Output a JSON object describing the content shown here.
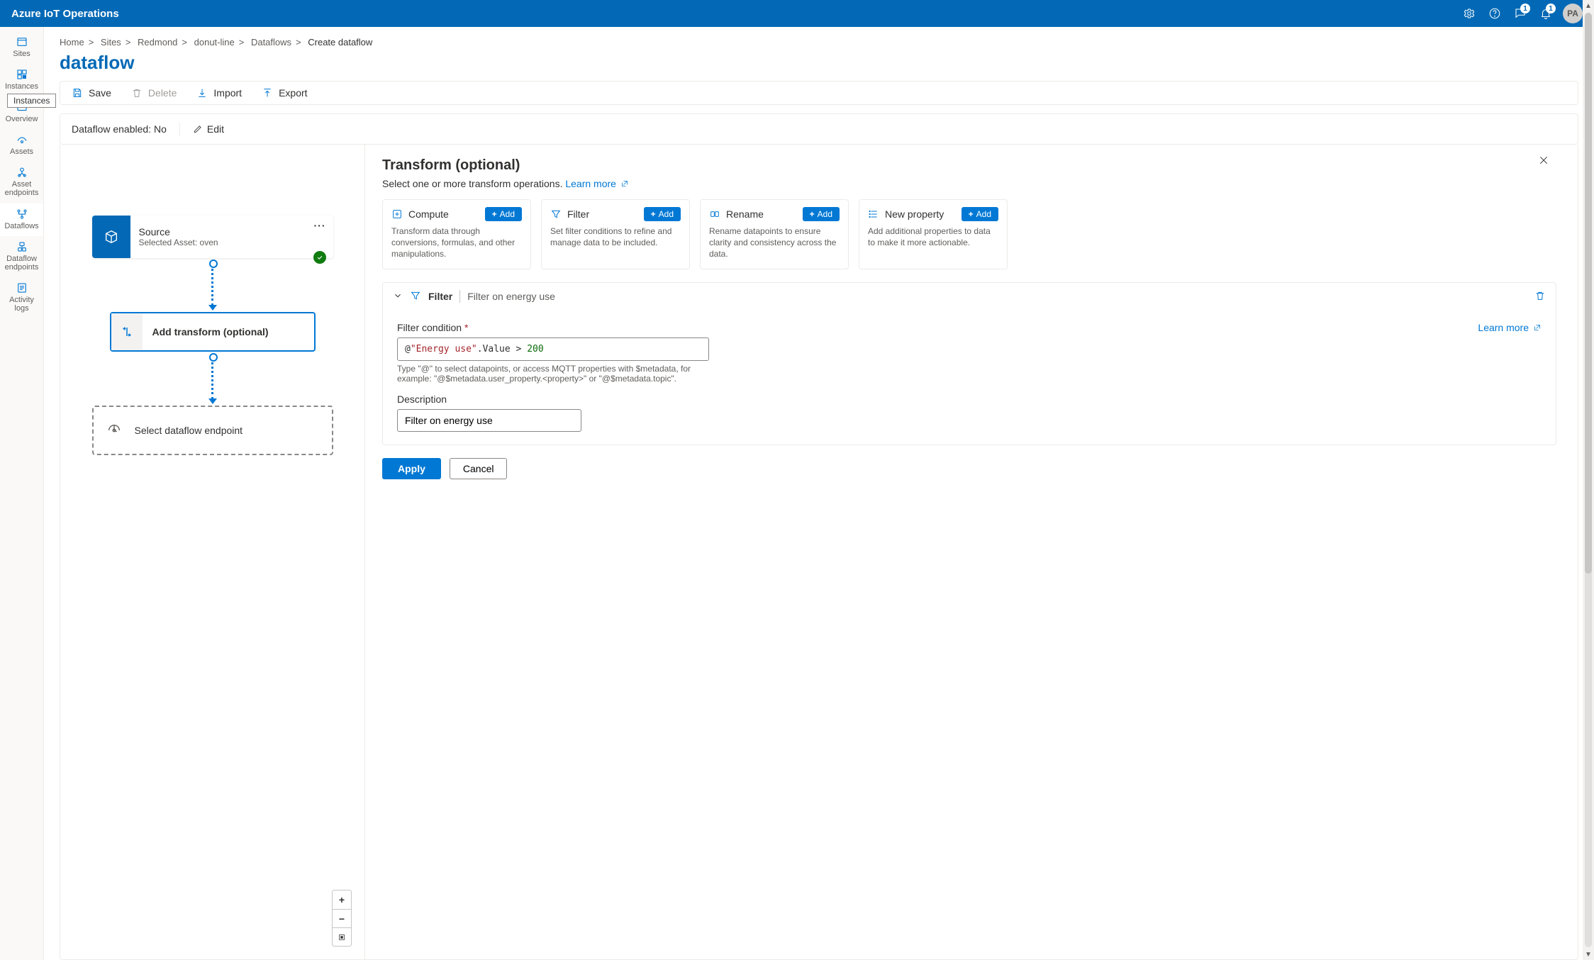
{
  "header": {
    "brand": "Azure IoT Operations",
    "badge1": "1",
    "badge2": "1",
    "avatar": "PA"
  },
  "rail": {
    "tooltip": "Instances",
    "items": [
      {
        "label": "Sites"
      },
      {
        "label": "Instances"
      },
      {
        "label": "Overview"
      },
      {
        "label": "Assets"
      },
      {
        "label": "Asset\nendpoints"
      },
      {
        "label": "Dataflows"
      },
      {
        "label": "Dataflow\nendpoints"
      },
      {
        "label": "Activity\nlogs"
      }
    ]
  },
  "breadcrumbs": {
    "items": [
      "Home",
      "Sites",
      "Redmond",
      "donut-line",
      "Dataflows",
      "Create dataflow"
    ]
  },
  "page": {
    "title": "dataflow"
  },
  "toolbar": {
    "save": "Save",
    "delete": "Delete",
    "import": "Import",
    "export": "Export"
  },
  "enabled": {
    "text": "Dataflow enabled: No",
    "edit": "Edit"
  },
  "canvas": {
    "source_title": "Source",
    "source_sub": "Selected Asset: oven",
    "transform_label": "Add transform (optional)",
    "endpoint_label": "Select dataflow endpoint"
  },
  "panel": {
    "title": "Transform (optional)",
    "subtitle": "Select one or more transform operations. ",
    "learn_more": "Learn more",
    "tiles": [
      {
        "name": "Compute",
        "desc": "Transform data through conversions, formulas, and other manipulations.",
        "btn": "Add"
      },
      {
        "name": "Filter",
        "desc": "Set filter conditions to refine and manage data to be included.",
        "btn": "Add"
      },
      {
        "name": "Rename",
        "desc": "Rename datapoints to ensure clarity and consistency across the data.",
        "btn": "Add"
      },
      {
        "name": "New property",
        "desc": "Add additional properties to data to make it more actionable.",
        "btn": "Add"
      }
    ],
    "filter_block": {
      "label": "Filter",
      "summary": "Filter on energy use",
      "condition_label": "Filter condition",
      "learn": "Learn more",
      "condition_value_parts": {
        "at": "@",
        "str": "\"Energy use\"",
        "prop": ".Value",
        "op": " > ",
        "num": "200"
      },
      "hint": "Type \"@\" to select datapoints, or access MQTT properties with $metadata, for example: \"@$metadata.user_property.<property>\" or \"@$metadata.topic\".",
      "desc_label": "Description",
      "desc_value": "Filter on energy use"
    },
    "actions": {
      "apply": "Apply",
      "cancel": "Cancel"
    }
  }
}
